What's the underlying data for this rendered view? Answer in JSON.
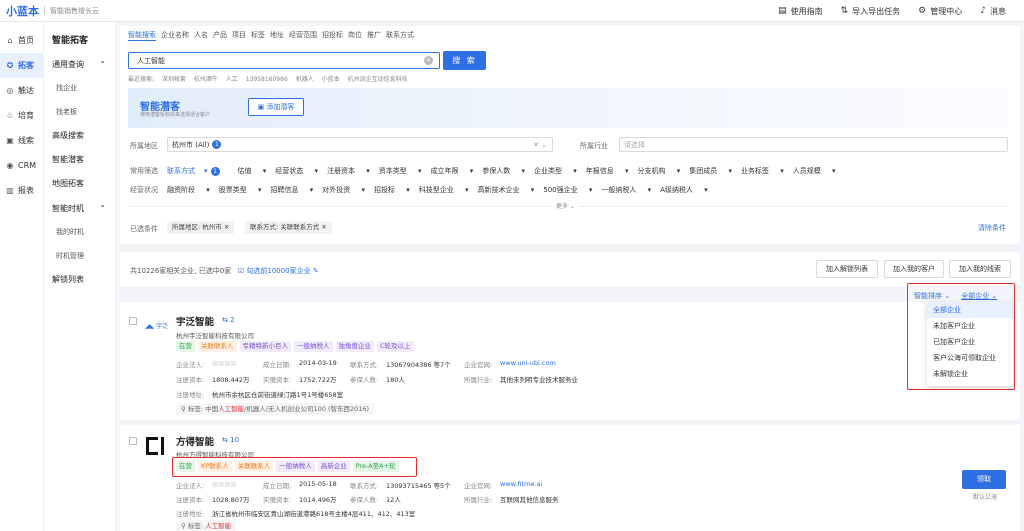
{
  "topbar": {
    "logo": "小蓝本",
    "slogan": "智能销售增长云",
    "items": [
      {
        "icon": "book-icon",
        "glyph": "▤",
        "label": "使用指南"
      },
      {
        "icon": "import-export-icon",
        "glyph": "⇅",
        "label": "导入导出任务"
      },
      {
        "icon": "gear-icon",
        "glyph": "⚙",
        "label": "管理中心"
      },
      {
        "icon": "bell-icon",
        "glyph": "♪",
        "label": "消息"
      }
    ]
  },
  "sidebar": [
    {
      "icon": "home-icon",
      "glyph": "⌂",
      "label": "首页"
    },
    {
      "icon": "compass-icon",
      "glyph": "✪",
      "label": "拓客"
    },
    {
      "icon": "target-icon",
      "glyph": "◎",
      "label": "触达"
    },
    {
      "icon": "leaf-icon",
      "glyph": "♧",
      "label": "培育"
    },
    {
      "icon": "clue-icon",
      "glyph": "▣",
      "label": "线索"
    },
    {
      "icon": "crm-icon",
      "glyph": "◉",
      "label": "CRM"
    },
    {
      "icon": "report-icon",
      "glyph": "▥",
      "label": "报表"
    }
  ],
  "subnav": {
    "title": "智能拓客",
    "group1": "通用查询",
    "sub1": [
      "找企业",
      "找老板"
    ],
    "items": [
      "高级搜索",
      "智能潜客",
      "地图拓客"
    ],
    "group2": "智能时机",
    "sub2": [
      "我的时机",
      "时机管理"
    ],
    "last": "解锁列表"
  },
  "search": {
    "tabs": [
      "智能搜索",
      "企业名称",
      "人名",
      "产品",
      "项目",
      "标签",
      "地址",
      "经营范围",
      "招投标",
      "岗位",
      "推广",
      "联系方式"
    ],
    "value": "人工智能",
    "button": "搜 索",
    "recent_label": "最近搜索:",
    "recent": [
      "深圳帐套",
      "杭州酒牛",
      "人工",
      "13958160986",
      "机器人",
      "小蓝本",
      "杭州派企互动信息科技"
    ]
  },
  "banner": {
    "title": "智能潜客",
    "subtitle": "使用潜客投标快来选择适合客户",
    "button": "添加潜客"
  },
  "filters": {
    "region_label": "所属地区",
    "region_value": "杭州市 (All)",
    "region_count": "1",
    "industry_label": "所属行业",
    "industry_placeholder": "请选择",
    "common_label": "常用筛选",
    "common": [
      "联系方式",
      "估值",
      "经营状态",
      "注册资本",
      "资本类型",
      "成立年限",
      "参保人数",
      "企业类型",
      "年报信息",
      "分支机构",
      "集团成员",
      "业务标签",
      "人员规模"
    ],
    "common_count": "1",
    "status_label": "经营状况",
    "status": [
      "融资阶段",
      "股票类型",
      "招聘信息",
      "对外投资",
      "招投标",
      "科技型企业",
      "高新技术企业",
      "500强企业",
      "一般纳税人",
      "A级纳税人"
    ],
    "more": "更多",
    "selected_label": "已选条件",
    "chips": [
      "所属地区: 杭州市",
      "联系方式: 关联联系方式"
    ],
    "clear_all": "清除条件"
  },
  "results": {
    "count_text": "共10226家相关企业, 已选中0家",
    "select_link": "勾选前10000家企业",
    "actions": [
      "加入解锁列表",
      "加入我的客户",
      "加入我的线索"
    ],
    "sort": "智能排序",
    "scope": "全部企业",
    "dropdown": [
      "全部企业",
      "未加客户企业",
      "已加客户企业",
      "客户公海可领取企业",
      "未解锁企业"
    ]
  },
  "companies": [
    {
      "name": "宇泛智能",
      "related": "2",
      "legal": "杭州宇泛智能科技有限公司",
      "logo_text": "宇泛",
      "tags": [
        "在营",
        "关联联系人",
        "专精特新小巨人",
        "一般纳税人",
        "独角兽企业",
        "C轮及以上"
      ],
      "fields": {
        "legal_person_label": "企业法人:",
        "legal_person": "",
        "found_date_label": "成立日期:",
        "found_date": "2014-03-19",
        "contact_label": "联系方式:",
        "contact": "13067904386 等7个",
        "website_label": "企业官网:",
        "website": "www.uni-ubi.com",
        "capital_label": "注册资本:",
        "capital": "1808.442万",
        "paid_label": "实缴资本:",
        "paid": "1752.722万",
        "insured_label": "参保人数:",
        "insured": "180人",
        "industry_label": "所属行业:",
        "industry": "其他未列明专业技术服务业",
        "address_label": "注册地址:",
        "address": "杭州市余杭区仓前街道绿汀路1号1号楼658室"
      },
      "keyword_prefix": "标签: 中国",
      "keyword_hl": "人工智能",
      "keyword_rest": "/机器人/无人机创业公司100 (智东西2016)"
    },
    {
      "name": "方得智能",
      "related": "10",
      "legal": "杭州方得智能科技有限公司",
      "tags": [
        "在营",
        "KP联系人",
        "关联联系人",
        "一般纳税人",
        "高新企业",
        "Pre-A至A+轮"
      ],
      "fields": {
        "legal_person_label": "企业法人:",
        "legal_person": "",
        "found_date_label": "成立日期:",
        "found_date": "2015-05-18",
        "contact_label": "联系方式:",
        "contact": "13093715465 等5个",
        "website_label": "企业官网:",
        "website": "www.fitme.ai",
        "capital_label": "注册资本:",
        "capital": "1028.807万",
        "paid_label": "实缴资本:",
        "paid": "1014.496万",
        "insured_label": "参保人数:",
        "insured": "12人",
        "industry_label": "所属行业:",
        "industry": "互联网其他信息服务",
        "address_label": "注册地址:",
        "address": "浙江省杭州市临安区青山湖街道港路618号主楼4层411、412、413室"
      },
      "keyword_prefix": "标签: ",
      "keyword_hl": "人工智能",
      "keyword_rest": "",
      "claim": "领取",
      "claim_sub": "默认公海"
    }
  ],
  "colors": {
    "accent": "#2f6fe4",
    "highlight": "#e62b2b"
  }
}
